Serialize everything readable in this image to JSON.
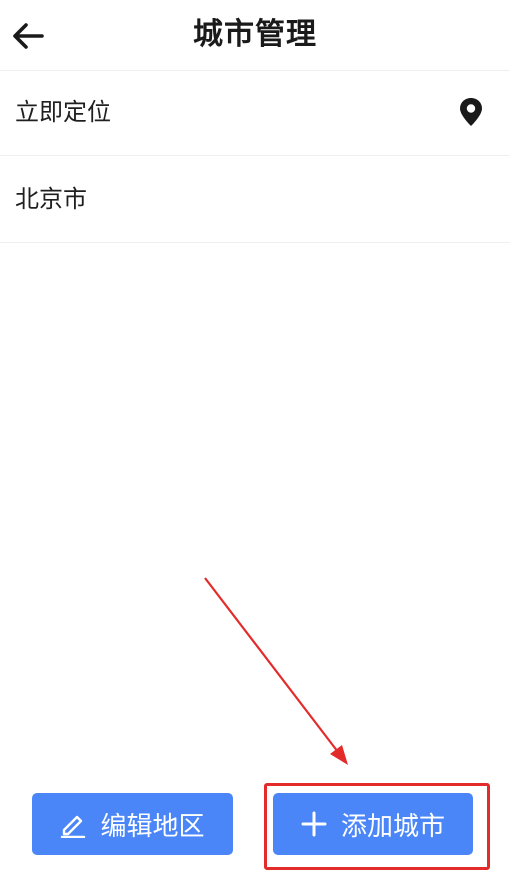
{
  "header": {
    "title": "城市管理",
    "back_icon": "arrow-left-icon"
  },
  "list": {
    "items": [
      {
        "label": "立即定位",
        "icon": "location-pin-icon"
      },
      {
        "label": "北京市"
      }
    ]
  },
  "footer": {
    "edit_label": "编辑地区",
    "edit_icon": "pencil-icon",
    "add_label": "添加城市",
    "add_icon": "plus-icon"
  },
  "colors": {
    "button_bg": "#4a86f7",
    "annotation": "#e32b2b",
    "divider": "#efefef"
  }
}
